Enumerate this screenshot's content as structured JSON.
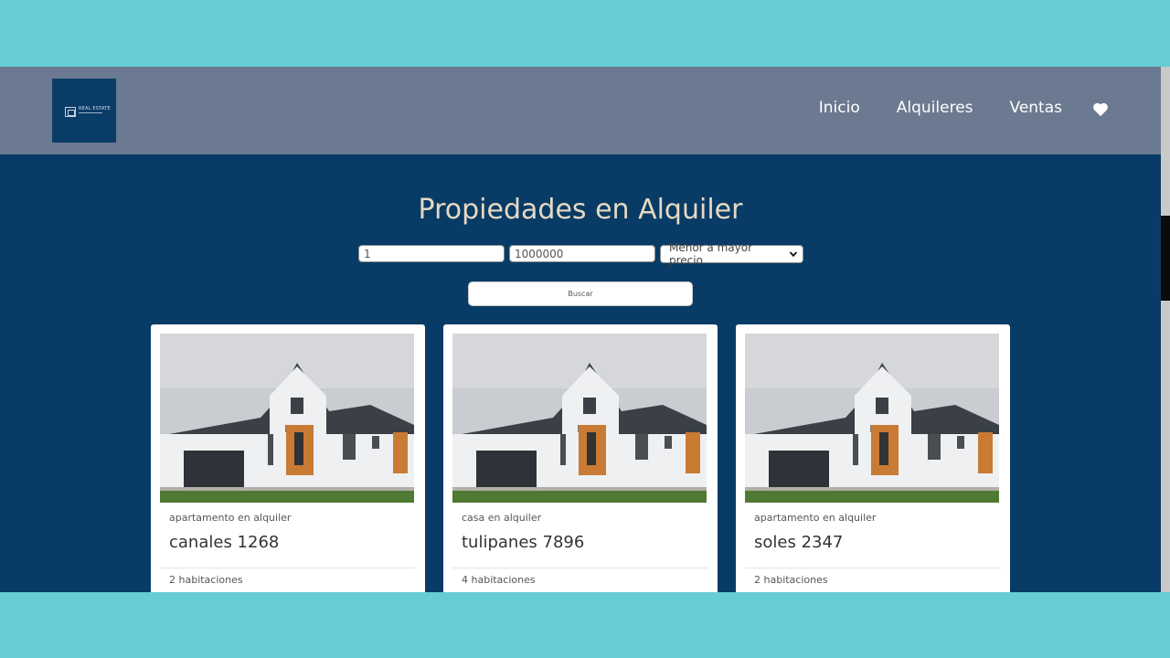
{
  "colors": {
    "page_bg": "#66cdd6",
    "navbar_bg": "#6b7a90",
    "main_bg": "#083c66",
    "title_color": "#e6d9c3"
  },
  "header": {
    "logo_text": "REAL ESTATE",
    "nav": [
      {
        "label": "Inicio"
      },
      {
        "label": "Alquileres"
      },
      {
        "label": "Ventas"
      }
    ],
    "favorites_icon": "heart-icon"
  },
  "main": {
    "title": "Propiedades en Alquiler",
    "filters": {
      "min_price": "1",
      "max_price": "1000000",
      "sort_selected": "Menor a mayor precio"
    },
    "search_label": "Buscar",
    "properties": [
      {
        "type": "apartamento en alquiler",
        "address": "canales 1268",
        "rooms": "2 habitaciones"
      },
      {
        "type": "casa en alquiler",
        "address": "tulipanes 7896",
        "rooms": "4 habitaciones"
      },
      {
        "type": "apartamento en alquiler",
        "address": "soles 2347",
        "rooms": "2 habitaciones"
      }
    ]
  }
}
